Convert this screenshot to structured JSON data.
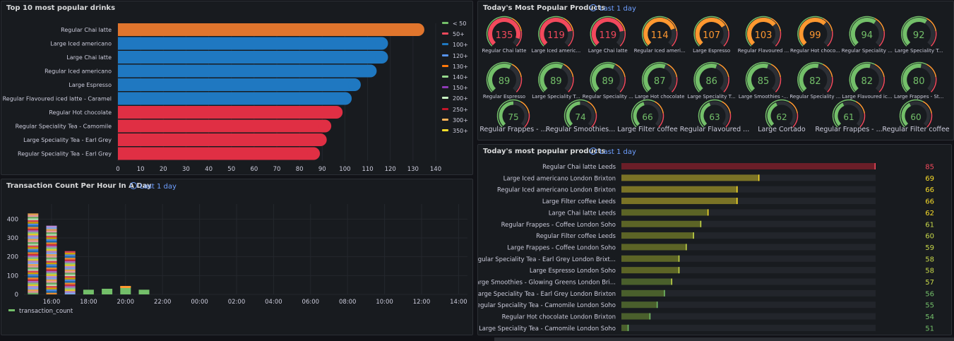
{
  "colors": {
    "green": "#73bf69",
    "red": "#f2495c",
    "orange": "#ff9830",
    "blue": "#1f78c1",
    "darkorange": "#e0752d"
  },
  "panels": {
    "drinks_title": "Top 10 most popular drinks",
    "gauges_title": "Today's Most Popular Products",
    "gauges_time": "Last 1 day",
    "tx_title": "Transaction Count Per Hour In A Day",
    "tx_time": "Last 1 day",
    "products_title": "Today's most popular products",
    "products_time": "Last 1 day"
  },
  "chart_data": [
    {
      "type": "bar",
      "orientation": "horizontal",
      "title": "Top 10 most popular drinks",
      "categories": [
        "Regular Chai latte",
        "Large Iced americano",
        "Large Chai latte",
        "Regular Iced americano",
        "Large Espresso",
        "Regular Flavoured iced latte - Caramel",
        "Regular Hot chocolate",
        "Regular Speciality Tea - Camomile",
        "Large Speciality Tea - Earl Grey",
        "Regular Speciality Tea - Earl Grey"
      ],
      "values": [
        135,
        119,
        119,
        114,
        107,
        103,
        99,
        94,
        92,
        89
      ],
      "bar_colors": [
        "#e0752d",
        "#1f78c1",
        "#1f78c1",
        "#1f78c1",
        "#1f78c1",
        "#1f78c1",
        "#e02f44",
        "#e02f44",
        "#e02f44",
        "#e02f44"
      ],
      "xlim": [
        0,
        140
      ],
      "xticks": [
        "0",
        "10",
        "20",
        "30",
        "40",
        "50",
        "60",
        "70",
        "80",
        "90",
        "100",
        "110",
        "120",
        "130",
        "140"
      ],
      "legend": [
        {
          "label": "< 50",
          "color": "#73bf69"
        },
        {
          "label": "50+",
          "color": "#f2495c"
        },
        {
          "label": "100+",
          "color": "#1f78c1"
        },
        {
          "label": "120+",
          "color": "#5794f2"
        },
        {
          "label": "130+",
          "color": "#ff780a"
        },
        {
          "label": "140+",
          "color": "#96d98d"
        },
        {
          "label": "150+",
          "color": "#8f3bb8"
        },
        {
          "label": "200+",
          "color": "#c8f2c2"
        },
        {
          "label": "250+",
          "color": "#c4162a"
        },
        {
          "label": "300+",
          "color": "#ffb357"
        },
        {
          "label": "350+",
          "color": "#fade2a"
        }
      ],
      "legend_placement": "right"
    },
    {
      "type": "gauge",
      "title": "Today's Most Popular Products",
      "items": [
        {
          "label": "Regular Chai latte",
          "value": 135,
          "color": "#f2495c"
        },
        {
          "label": "Large Iced americ...",
          "value": 119,
          "color": "#f2495c"
        },
        {
          "label": "Large Chai latte",
          "value": 119,
          "color": "#f2495c"
        },
        {
          "label": "Regular Iced ameri...",
          "value": 114,
          "color": "#ff9830"
        },
        {
          "label": "Large Espresso",
          "value": 107,
          "color": "#ff9830"
        },
        {
          "label": "Regular Flavoured ...",
          "value": 103,
          "color": "#ff9830"
        },
        {
          "label": "Regular Hot choco...",
          "value": 99,
          "color": "#ff9830"
        },
        {
          "label": "Regular Speciality ...",
          "value": 94,
          "color": "#73bf69"
        },
        {
          "label": "Large Speciality T...",
          "value": 92,
          "color": "#73bf69"
        },
        {
          "label": "Regular Espresso",
          "value": 89,
          "color": "#73bf69"
        },
        {
          "label": "Large Speciality T...",
          "value": 89,
          "color": "#73bf69"
        },
        {
          "label": "Regular Speciality ...",
          "value": 89,
          "color": "#73bf69"
        },
        {
          "label": "Large Hot chocolate",
          "value": 87,
          "color": "#73bf69"
        },
        {
          "label": "Large Speciality T...",
          "value": 86,
          "color": "#73bf69"
        },
        {
          "label": "Large Smoothies -...",
          "value": 85,
          "color": "#73bf69"
        },
        {
          "label": "Regular Speciality ...",
          "value": 82,
          "color": "#73bf69"
        },
        {
          "label": "Large Flavoured ic...",
          "value": 82,
          "color": "#73bf69"
        },
        {
          "label": "Large Frappes - St...",
          "value": 80,
          "color": "#73bf69"
        },
        {
          "label": "Regular Frappes - ...",
          "value": 75,
          "color": "#73bf69"
        },
        {
          "label": "Regular Smoothies...",
          "value": 74,
          "color": "#73bf69"
        },
        {
          "label": "Large Filter coffee",
          "value": 66,
          "color": "#73bf69"
        },
        {
          "label": "Regular Flavoured ...",
          "value": 63,
          "color": "#73bf69"
        },
        {
          "label": "Large Cortado",
          "value": 62,
          "color": "#73bf69"
        },
        {
          "label": "Regular Frappes - ...",
          "value": 61,
          "color": "#73bf69"
        },
        {
          "label": "Regular Filter coffee",
          "value": 60,
          "color": "#73bf69"
        }
      ]
    },
    {
      "type": "bar",
      "stacked": true,
      "title": "Transaction Count Per Hour In A Day",
      "x": [
        "15:00",
        "16:00",
        "17:00",
        "18:00",
        "19:00",
        "20:00",
        "21:00"
      ],
      "values": [
        430,
        365,
        230,
        25,
        30,
        45,
        25
      ],
      "xticks": [
        "16:00",
        "18:00",
        "20:00",
        "22:00",
        "00:00",
        "02:00",
        "04:00",
        "06:00",
        "08:00",
        "10:00",
        "12:00",
        "14:00"
      ],
      "yticks": [
        "0",
        "100",
        "200",
        "300",
        "400"
      ],
      "ylim": [
        0,
        480
      ],
      "series": [
        {
          "name": "transaction_count",
          "color": "#73bf69"
        }
      ],
      "legend_placement": "bottom"
    },
    {
      "type": "bar",
      "orientation": "horizontal",
      "title": "Today's most popular products",
      "categories": [
        "Regular Chai latte Leeds",
        "Large Iced americano London Brixton",
        "Regular Iced americano London Brixton",
        "Large Filter coffee Leeds",
        "Large Chai latte Leeds",
        "Regular Frappes - Coffee London Soho",
        "Regular Filter coffee Leeds",
        "Large Frappes - Coffee London Soho",
        "Regular Speciality Tea - Earl Grey London Brixt...",
        "Large Espresso London Soho",
        "Large Smoothies - Glowing Greens London Bri...",
        "Large Speciality Tea - Earl Grey London Brixton",
        "Regular Speciality Tea - Camomile London Soho",
        "Regular Hot chocolate London Brixton",
        "Large Speciality Tea - Camomile London Soho"
      ],
      "values": [
        85,
        69,
        66,
        66,
        62,
        61,
        60,
        59,
        58,
        58,
        57,
        56,
        55,
        54,
        51
      ],
      "value_colors": [
        "#f2495c",
        "#fade2a",
        "#fade2a",
        "#fade2a",
        "#fade2a",
        "#c8d94a",
        "#c8d94a",
        "#c8d94a",
        "#c8d94a",
        "#c8d94a",
        "#c8d94a",
        "#73bf69",
        "#73bf69",
        "#73bf69",
        "#73bf69"
      ],
      "xlim": [
        50,
        85
      ]
    }
  ]
}
